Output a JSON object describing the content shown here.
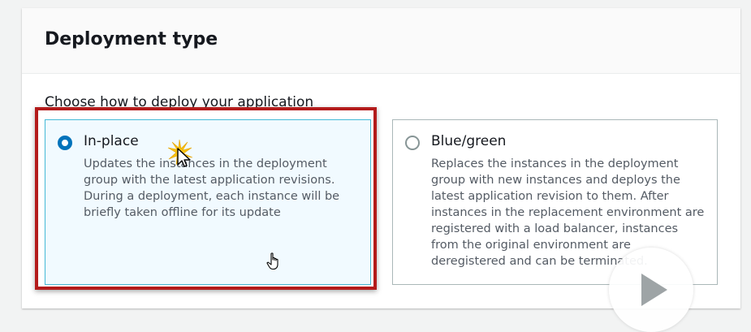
{
  "panel": {
    "title": "Deployment type",
    "instruction": "Choose how to deploy your application"
  },
  "options": [
    {
      "label": "In-place",
      "selected": true,
      "description": "Updates the instances in the deployment group with the latest application revisions. During a deployment, each instance will be briefly taken offline for its update"
    },
    {
      "label": "Blue/green",
      "selected": false,
      "description": "Replaces the instances in the deployment group with new instances and deploys the latest application revision to them. After instances in the replacement environment are registered with a load balancer, instances from the original environment are deregistered and can be terminated."
    }
  ],
  "colors": {
    "selected_radio": "#0073bb",
    "selected_border": "#44b9d6",
    "highlight_frame": "#b31b1b"
  },
  "icons": {
    "cursor": "arrow-cursor-with-click-burst",
    "hand": "hand-pointer-cursor",
    "video": "play-icon"
  }
}
